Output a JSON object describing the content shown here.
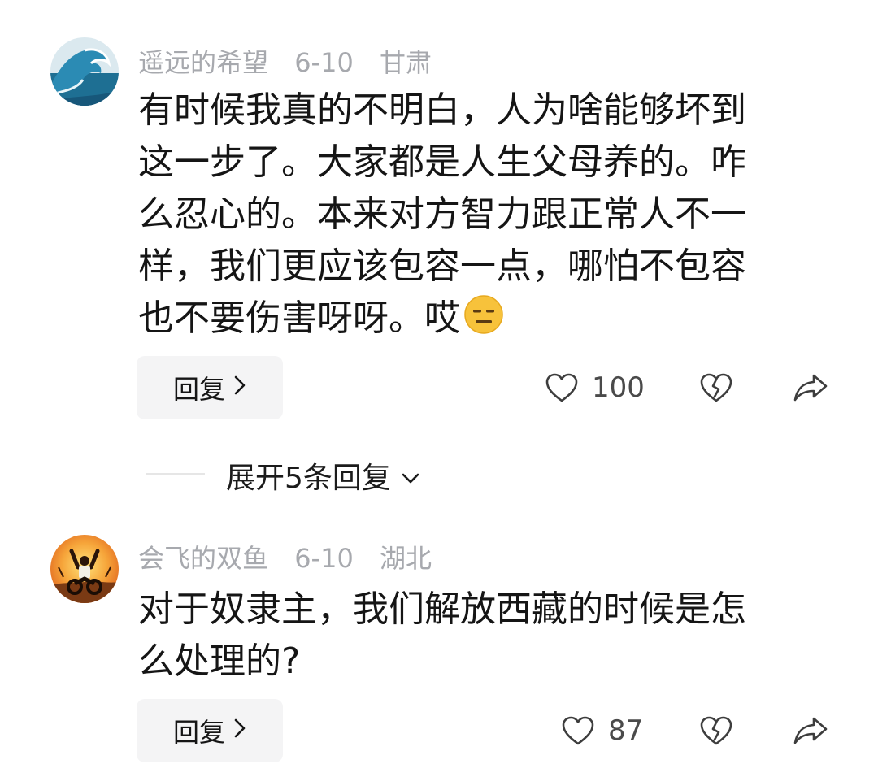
{
  "comments": [
    {
      "username": "遥远的希望",
      "date": "6-10",
      "location": "甘肃",
      "avatar_icon": "wave-avatar",
      "text_lines": [
        "有时候我真的不明白，人为啥能够坏到",
        "这一步了。大家都是人生父母养的。咋",
        "么忍心的。本来对方智力跟正常人不一",
        "样，我们更应该包容一点，哪怕不包容",
        "也不要伤害呀呀。哎"
      ],
      "emoji": "expressionless-face",
      "reply_label": "回复",
      "likes": "100"
    },
    {
      "username": "会飞的双鱼",
      "date": "6-10",
      "location": "湖北",
      "avatar_icon": "motorcycle-rider-avatar",
      "text_lines": [
        "对于奴隶主，我们解放西藏的时候是怎",
        "么处理的?"
      ],
      "reply_label": "回复",
      "likes": "87"
    }
  ],
  "expand_replies": {
    "label": "展开5条回复"
  },
  "colors": {
    "meta_text": "#a7a9ae",
    "body_text": "#151515",
    "reply_bg": "#f4f4f5",
    "icon_stroke": "#3d3d3d"
  }
}
